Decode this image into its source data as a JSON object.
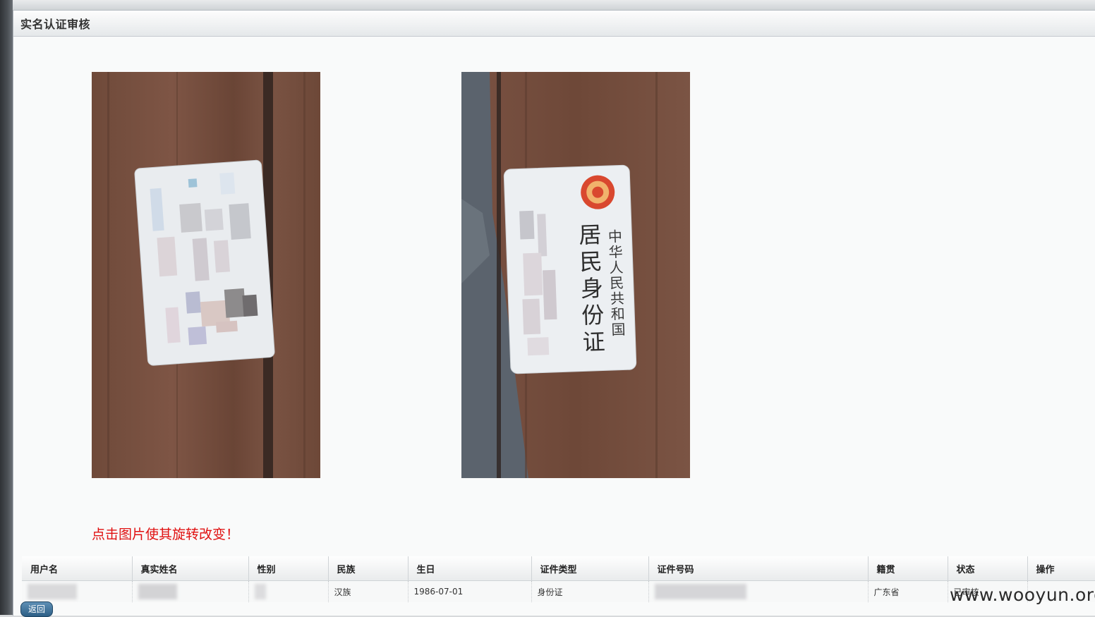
{
  "page": {
    "title": "实名认证审核"
  },
  "photos": {
    "front": {
      "card_label": ""
    },
    "back": {
      "line1": "中华人民共和国",
      "line2": "居民身份证"
    }
  },
  "hint": "点击图片使其旋转改变！",
  "table": {
    "columns": [
      "用户名",
      "真实姓名",
      "性别",
      "民族",
      "生日",
      "证件类型",
      "证件号码",
      "籍贯",
      "状态",
      "操作"
    ],
    "row": {
      "username": "",
      "realname": "",
      "gender": "",
      "ethnicity": "汉族",
      "birthday": "1986-07-01",
      "id_type": "身份证",
      "id_number": "",
      "native_place": "广东省",
      "status": "已审核",
      "action": ""
    }
  },
  "buttons": {
    "back": "返回"
  },
  "watermark": "www.wooyun.org"
}
